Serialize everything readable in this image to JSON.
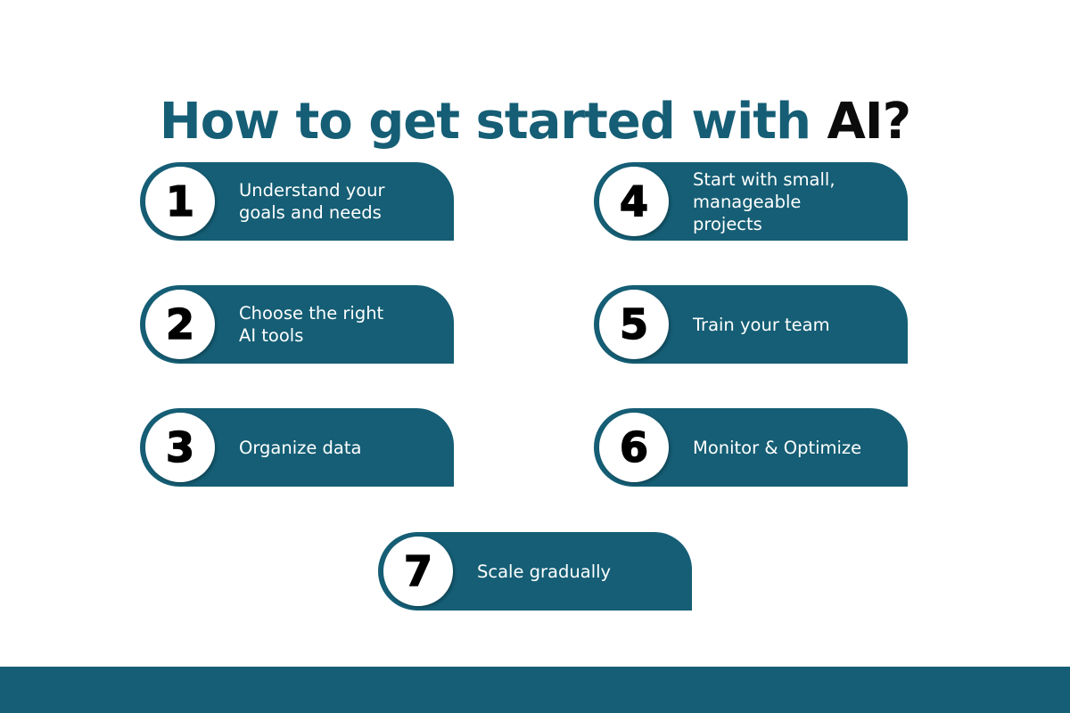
{
  "title": {
    "main": "How to get started with ",
    "accent": "AI?"
  },
  "steps": [
    {
      "number": "1",
      "label": "Understand your\ngoals and needs"
    },
    {
      "number": "2",
      "label": "Choose the right\nAI tools"
    },
    {
      "number": "3",
      "label": "Organize data"
    },
    {
      "number": "4",
      "label": "Start with small,\nmanageable\nprojects"
    },
    {
      "number": "5",
      "label": "Train your team"
    },
    {
      "number": "6",
      "label": "Monitor & Optimize"
    },
    {
      "number": "7",
      "label": "Scale gradually"
    }
  ],
  "colors": {
    "primary": "#155e75",
    "accent_text": "#0b0b0b",
    "background": "#ffffff"
  }
}
